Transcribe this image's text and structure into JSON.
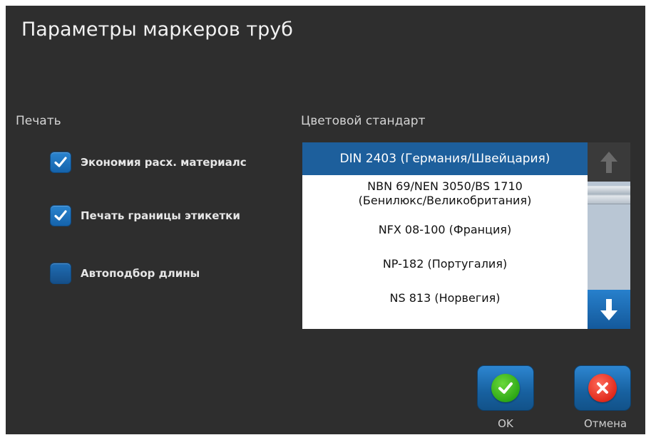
{
  "dialog": {
    "title": "Параметры маркеров труб"
  },
  "print_section": {
    "label": "Печать",
    "options": [
      {
        "label": "Экономия расх. материалс",
        "checked": true
      },
      {
        "label": "Печать границы этикетки",
        "checked": true
      },
      {
        "label": "Автоподбор длины",
        "checked": false
      }
    ]
  },
  "color_standard": {
    "label": "Цветовой стандарт",
    "items": [
      {
        "line1": "DIN 2403 (Германия/Швейцария)",
        "line2": "",
        "selected": true
      },
      {
        "line1": "NBN 69/NEN 3050/BS 1710",
        "line2": "(Бенилюкс/Великобритания)",
        "selected": false
      },
      {
        "line1": "NFX 08-100 (Франция)",
        "line2": "",
        "selected": false
      },
      {
        "line1": "NP-182 (Португалия)",
        "line2": "",
        "selected": false
      },
      {
        "line1": "NS 813 (Норвегия)",
        "line2": "",
        "selected": false
      }
    ],
    "scroll_up_icon": "arrow-up-icon",
    "scroll_down_icon": "arrow-down-icon"
  },
  "actions": {
    "ok_label": "OK",
    "ok_icon": "checkmark-icon",
    "cancel_label": "Отмена",
    "cancel_icon": "close-icon"
  },
  "colors": {
    "background": "#2e2e2e",
    "accent": "#1d5f9c",
    "ok_green": "#2ea817",
    "cancel_red": "#e02a1c"
  }
}
